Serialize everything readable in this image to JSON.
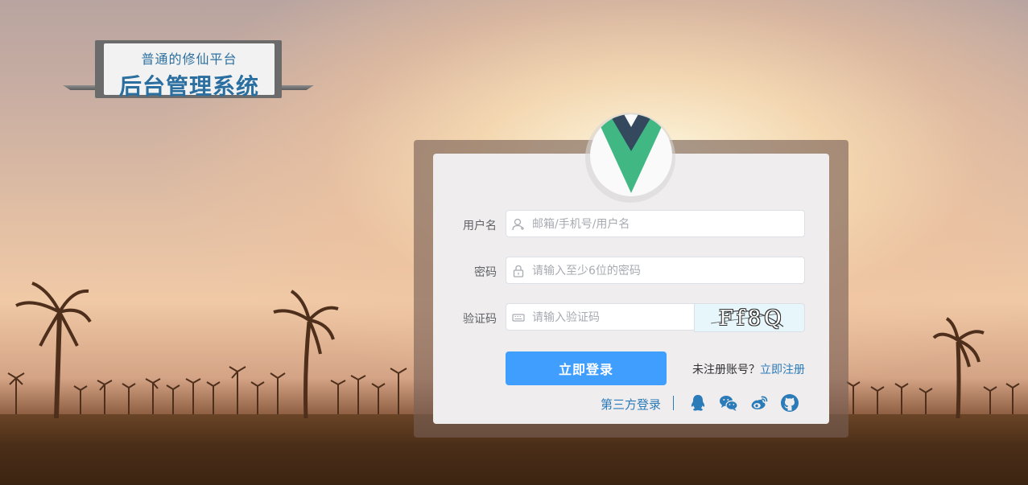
{
  "banner": {
    "subtitle": "普通的修仙平台",
    "title": "后台管理系统"
  },
  "login": {
    "username": {
      "label": "用户名",
      "placeholder": "邮箱/手机号/用户名",
      "value": ""
    },
    "password": {
      "label": "密码",
      "placeholder": "请输入至少6位的密码",
      "value": ""
    },
    "captcha": {
      "label": "验证码",
      "placeholder": "请输入验证码",
      "value": "",
      "image_text": "Ff8Q"
    },
    "submit_label": "立即登录",
    "register_prompt": "未注册账号？",
    "register_link": "立即注册",
    "third_party_label": "第三方登录",
    "third_party_icons": [
      "qq-icon",
      "wechat-icon",
      "weibo-icon",
      "github-icon"
    ]
  },
  "colors": {
    "accent": "#409eff",
    "link": "#2b7bb9",
    "vue_green": "#41b883",
    "vue_dark": "#35495e"
  }
}
